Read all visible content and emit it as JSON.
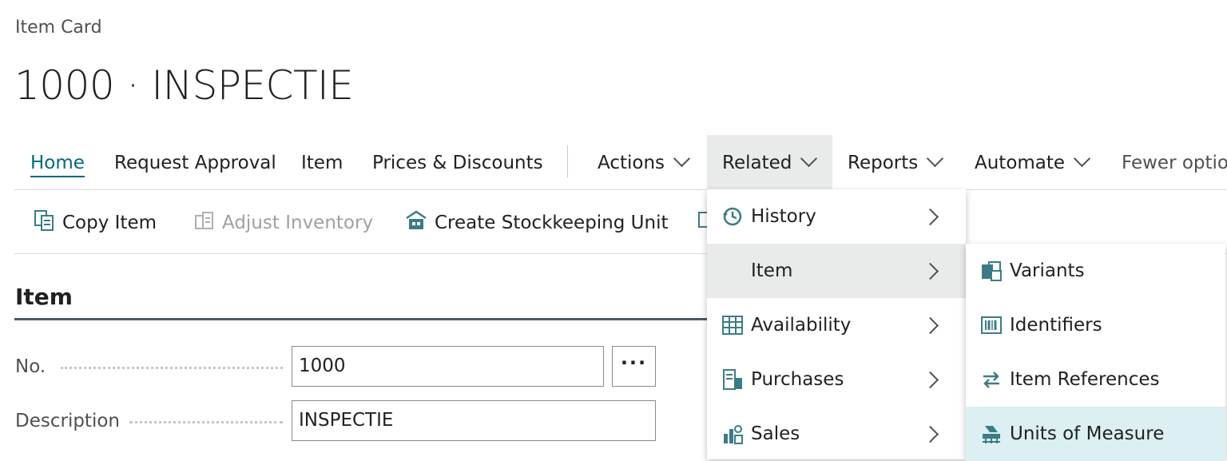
{
  "breadcrumb": "Item Card",
  "page_title": "1000 · INSPECTIE",
  "tabs": {
    "home": "Home",
    "request_approval": "Request Approval",
    "item": "Item",
    "prices_discounts": "Prices & Discounts",
    "actions": "Actions",
    "related": "Related",
    "reports": "Reports",
    "automate": "Automate",
    "fewer_options": "Fewer options"
  },
  "actions": {
    "copy_item": "Copy Item",
    "adjust_inventory": "Adjust Inventory",
    "create_stockkeeping_unit": "Create Stockkeeping Unit"
  },
  "section": {
    "title": "Item"
  },
  "fields": {
    "no_label": "No.",
    "no_value": "1000",
    "description_label": "Description",
    "description_value": "INSPECTIE",
    "lookup_label": "···"
  },
  "related_menu": {
    "history": "History",
    "item": "Item",
    "availability": "Availability",
    "purchases": "Purchases",
    "sales": "Sales"
  },
  "item_submenu": {
    "variants": "Variants",
    "identifiers": "Identifiers",
    "item_references": "Item References",
    "units_of_measure": "Units of Measure"
  },
  "colors": {
    "accent": "#00687a",
    "icon": "#3a7c86",
    "hover": "#e9eaea",
    "selected": "#dceff2"
  }
}
